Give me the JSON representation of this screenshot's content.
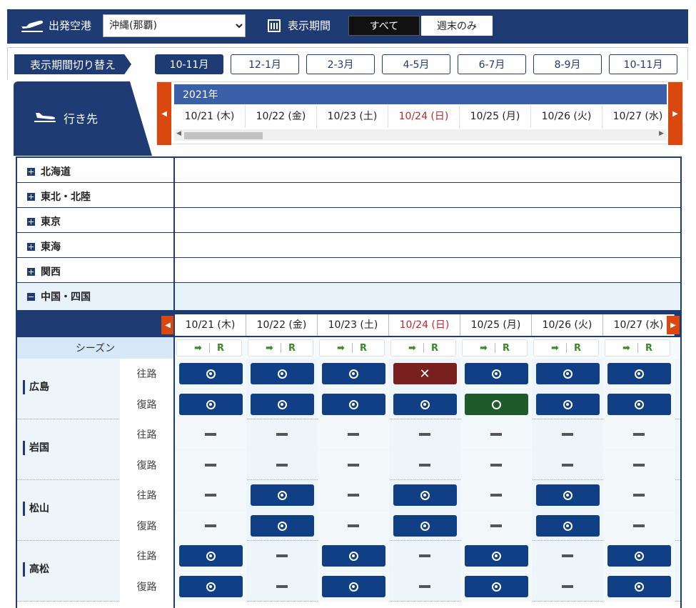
{
  "topbar": {
    "departure_label": "出発空港",
    "departure_value": "沖縄(那覇)",
    "period_label": "表示期間",
    "toggle_all": "すべて",
    "toggle_weekend": "週末のみ"
  },
  "period": {
    "label": "表示期間切り替え",
    "buttons": [
      "10-11月",
      "12-1月",
      "2-3月",
      "4-5月",
      "6-7月",
      "8-9月",
      "10-11月"
    ]
  },
  "destination": {
    "label": "行き先"
  },
  "header": {
    "year": "2021年",
    "dates": [
      "10/21 (木)",
      "10/22 (金)",
      "10/23 (土)",
      "10/24 (日)",
      "10/25 (月)",
      "10/26 (火)",
      "10/27 (水)"
    ]
  },
  "regions": [
    "北海道",
    "東北・北陸",
    "東京",
    "東海",
    "関西",
    "中国・四国"
  ],
  "season": {
    "label": "シーズン",
    "arrow": "➡",
    "r": "R"
  },
  "directions": {
    "out": "往路",
    "ret": "復路"
  },
  "cities": [
    {
      "name": "広島",
      "out": [
        "s",
        "s",
        "s",
        "x",
        "s",
        "s",
        "s"
      ],
      "ret": [
        "s",
        "s",
        "s",
        "s",
        "g",
        "s",
        "s"
      ]
    },
    {
      "name": "岩国",
      "out": [
        "-",
        "-",
        "-",
        "-",
        "-",
        "-",
        "-"
      ],
      "ret": [
        "-",
        "-",
        "-",
        "-",
        "-",
        "-",
        "-"
      ]
    },
    {
      "name": "松山",
      "out": [
        "-",
        "s",
        "-",
        "s",
        "-",
        "s",
        "-"
      ],
      "ret": [
        "-",
        "s",
        "-",
        "s",
        "-",
        "s",
        "-"
      ]
    },
    {
      "name": "高松",
      "out": [
        "s",
        "-",
        "s",
        "-",
        "s",
        "-",
        "s"
      ],
      "ret": [
        "s",
        "-",
        "s",
        "-",
        "s",
        "-",
        "s"
      ]
    }
  ],
  "colors": {
    "navy": "#1f3b73",
    "accent": "#d9480f",
    "sunday": "#c0282b",
    "seat_available": "#103f86",
    "seat_full": "#7a1f1f",
    "seat_few": "#1f5a2a"
  }
}
